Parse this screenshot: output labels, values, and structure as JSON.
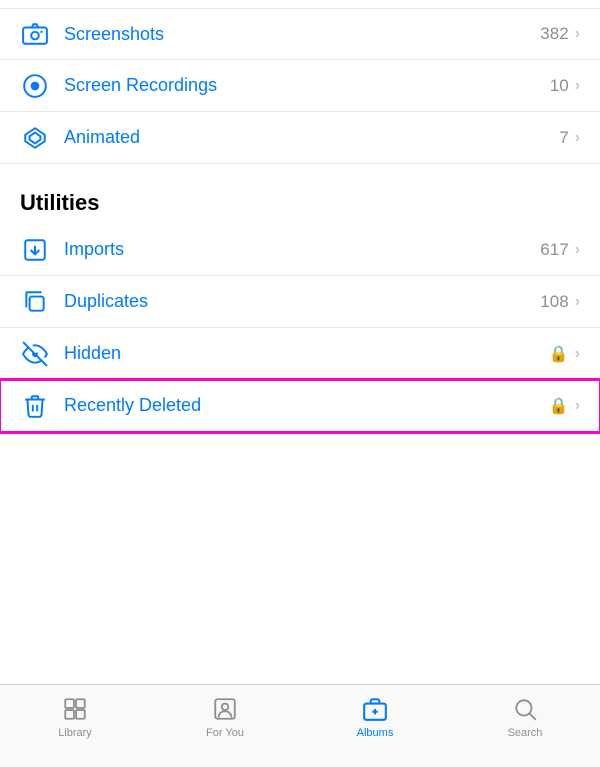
{
  "items_top": [
    {
      "id": "screenshots",
      "label": "Screenshots",
      "count": "382",
      "icon": "camera",
      "lock": false
    },
    {
      "id": "screen-recordings",
      "label": "Screen Recordings",
      "count": "10",
      "icon": "record",
      "lock": false
    },
    {
      "id": "animated",
      "label": "Animated",
      "count": "7",
      "icon": "animated",
      "lock": false
    }
  ],
  "utilities_header": "Utilities",
  "items_utilities": [
    {
      "id": "imports",
      "label": "Imports",
      "count": "617",
      "icon": "import",
      "lock": false
    },
    {
      "id": "duplicates",
      "label": "Duplicates",
      "count": "108",
      "icon": "duplicate",
      "lock": false
    },
    {
      "id": "hidden",
      "label": "Hidden",
      "count": "",
      "icon": "hidden",
      "lock": true
    },
    {
      "id": "recently-deleted",
      "label": "Recently Deleted",
      "count": "",
      "icon": "trash",
      "lock": true,
      "highlighted": true
    }
  ],
  "tabs": [
    {
      "id": "library",
      "label": "Library",
      "active": false,
      "icon": "library"
    },
    {
      "id": "for-you",
      "label": "For You",
      "active": false,
      "icon": "for-you"
    },
    {
      "id": "albums",
      "label": "Albums",
      "active": true,
      "icon": "albums"
    },
    {
      "id": "search",
      "label": "Search",
      "active": false,
      "icon": "search"
    }
  ]
}
